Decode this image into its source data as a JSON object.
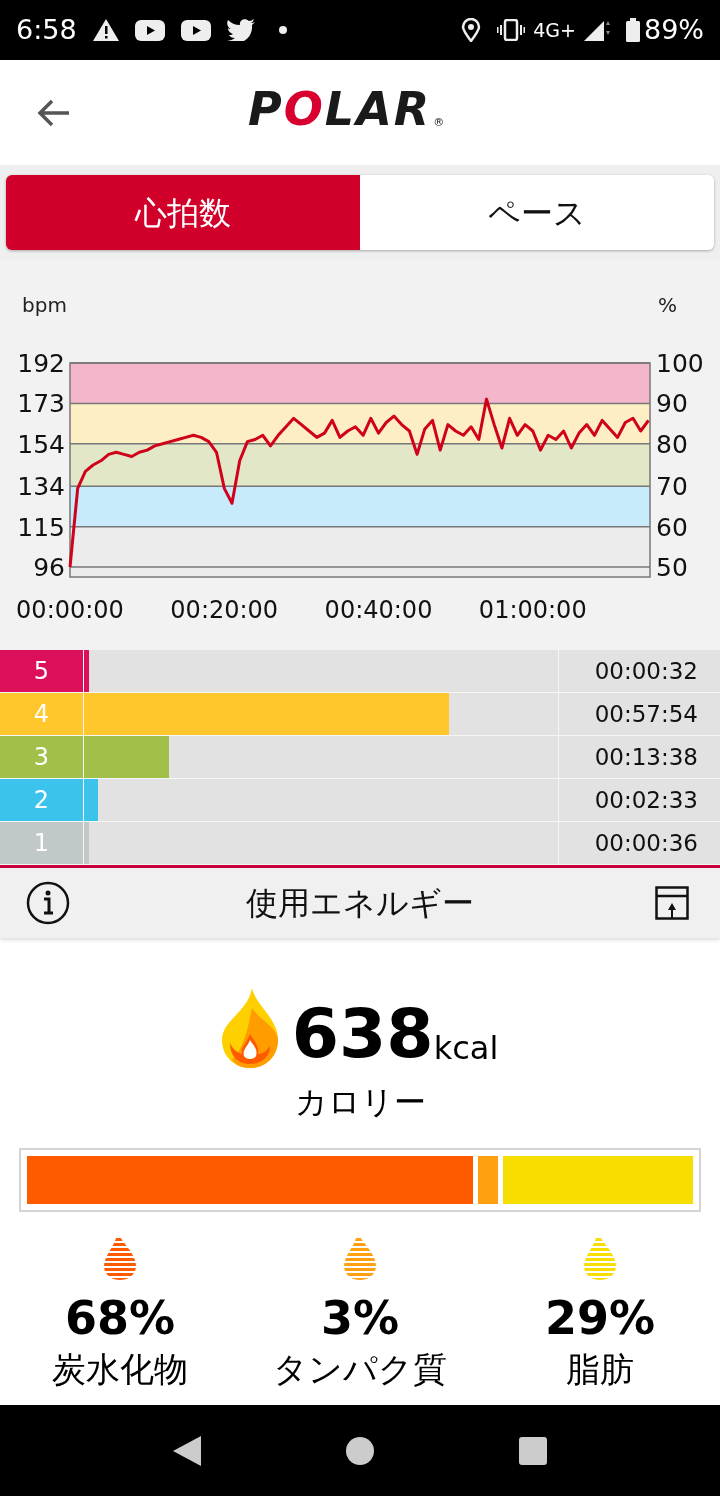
{
  "status_bar": {
    "time": "6:58",
    "network": "4G+",
    "battery": "89%"
  },
  "header": {
    "logo": "POLAR",
    "logo_mark": "®"
  },
  "tabs": [
    {
      "label": "心拍数",
      "selected": true
    },
    {
      "label": "ペース",
      "selected": false
    }
  ],
  "heart_rate_chart": {
    "percent_label": "%",
    "percent_ticks": [
      "100",
      "90",
      "80",
      "70",
      "60",
      "50"
    ],
    "chart_data": {
      "type": "line",
      "ylabel": "bpm",
      "ylim": [
        91.3,
        192
      ],
      "xlim": [
        0,
        75.2
      ],
      "grid": true,
      "bands": [
        {
          "axis": "y",
          "from": 91.3,
          "to": 115,
          "color": "#ececec"
        },
        {
          "axis": "y",
          "from": 115,
          "to": 134,
          "color": "#c7ebfa"
        },
        {
          "axis": "y",
          "from": 134,
          "to": 154,
          "color": "#e2e8c7"
        },
        {
          "axis": "y",
          "from": 154,
          "to": 173,
          "color": "#fdeec3"
        },
        {
          "axis": "y",
          "from": 173,
          "to": 192,
          "color": "#f4b6cb"
        }
      ],
      "yticks": [
        96,
        115,
        134,
        154,
        173,
        192
      ],
      "xticks": [
        {
          "value": 0,
          "label": "00:00:00"
        },
        {
          "value": 20,
          "label": "00:20:00"
        },
        {
          "value": 40,
          "label": "00:40:00"
        },
        {
          "value": 60,
          "label": "01:00:00"
        }
      ],
      "x": [
        0,
        1,
        2,
        3,
        4,
        5,
        6,
        7,
        8,
        9,
        10,
        11,
        12,
        13,
        14,
        15,
        16,
        17,
        18,
        19,
        20,
        21,
        22,
        23,
        24,
        25,
        26,
        27,
        28,
        29,
        30,
        31,
        32,
        33,
        34,
        35,
        36,
        37,
        38,
        39,
        40,
        41,
        42,
        43,
        44,
        45,
        46,
        47,
        48,
        49,
        50,
        51,
        52,
        53,
        54,
        55,
        56,
        57,
        58,
        59,
        60,
        61,
        62,
        63,
        64,
        65,
        66,
        67,
        68,
        69,
        70,
        71,
        72,
        73,
        74,
        75
      ],
      "series": [
        {
          "color": "#d0021b",
          "values": [
            96,
            133,
            141,
            144,
            146,
            149,
            150,
            149,
            148,
            150,
            151,
            153,
            154,
            155,
            156,
            157,
            158,
            157,
            155,
            150,
            133,
            126,
            146,
            155,
            156,
            158,
            153,
            158,
            162,
            166,
            163,
            160,
            157,
            159,
            165,
            157,
            160,
            162,
            158,
            166,
            159,
            164,
            167,
            163,
            160,
            149,
            161,
            165,
            151,
            163,
            160,
            158,
            162,
            156,
            175,
            163,
            152,
            166,
            158,
            163,
            160,
            151,
            158,
            156,
            160,
            152,
            159,
            163,
            158,
            165,
            161,
            157,
            164,
            166,
            160,
            165
          ]
        }
      ]
    }
  },
  "zones": [
    {
      "number": "5",
      "time": "00:00:32",
      "level": 0.01,
      "color": "#dc0f5a"
    },
    {
      "number": "4",
      "time": "00:57:54",
      "level": 0.77,
      "color": "#ffc72c"
    },
    {
      "number": "3",
      "time": "00:13:38",
      "level": 0.18,
      "color": "#a1c04a"
    },
    {
      "number": "2",
      "time": "00:02:33",
      "level": 0.03,
      "color": "#3cc3ec"
    },
    {
      "number": "1",
      "time": "00:00:36",
      "level": 0.01,
      "color": "#c0c8c8"
    }
  ],
  "energy": {
    "title": "使用エネルギー",
    "calories": "638",
    "unit": "kcal",
    "calories_label": "カロリー",
    "nutrients": [
      {
        "percent": "68%",
        "label": "炭水化物",
        "color": "#ff5a00"
      },
      {
        "percent": "3%",
        "label": "タンパク質",
        "color": "#ffa010"
      },
      {
        "percent": "29%",
        "label": "脂肪",
        "color": "#f7dd00"
      }
    ]
  }
}
